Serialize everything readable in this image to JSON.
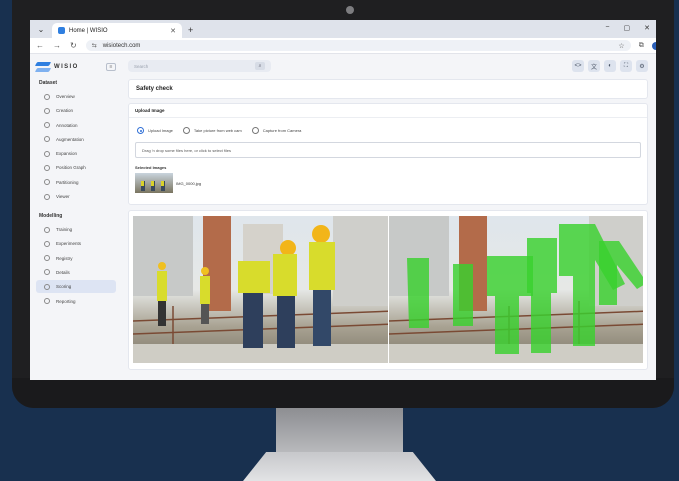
{
  "browser": {
    "tab_title": "Home | WISIO",
    "new_tab": "+",
    "url": "wisiotech.com",
    "window_controls": [
      "−",
      "▢",
      "✕"
    ]
  },
  "app": {
    "brand": "WISIO",
    "search_placeholder": "Search",
    "sidebar": {
      "dataset_section": "Dataset",
      "dataset_items": [
        {
          "label": "Overview",
          "icon": "overview-icon"
        },
        {
          "label": "Creation",
          "icon": "creation-icon"
        },
        {
          "label": "Annotation",
          "icon": "annotation-icon"
        },
        {
          "label": "Augmentation",
          "icon": "augmentation-icon"
        },
        {
          "label": "Expansion",
          "icon": "expansion-icon"
        },
        {
          "label": "Position Graph",
          "icon": "position-graph-icon"
        },
        {
          "label": "Partitioning",
          "icon": "partitioning-icon"
        },
        {
          "label": "Viewer",
          "icon": "viewer-icon"
        }
      ],
      "modelling_section": "Modelling",
      "modelling_items": [
        {
          "label": "Training",
          "icon": "training-icon"
        },
        {
          "label": "Experiments",
          "icon": "experiments-icon"
        },
        {
          "label": "Registry",
          "icon": "registry-icon"
        },
        {
          "label": "Details",
          "icon": "details-icon"
        },
        {
          "label": "Scoring",
          "icon": "scoring-icon",
          "active": true
        },
        {
          "label": "Reporting",
          "icon": "reporting-icon"
        }
      ]
    },
    "page_title": "Safety check",
    "upload": {
      "title": "Upload Image",
      "options": [
        "Upload Image",
        "Take picture from web cam",
        "Capture from Camera"
      ],
      "selected_option": "Upload Image",
      "dropzone_text": "Drag 'n drop some files here, or click to select files",
      "selected_label": "Selected Images",
      "file_name": "IMG_0000.jpg"
    }
  }
}
